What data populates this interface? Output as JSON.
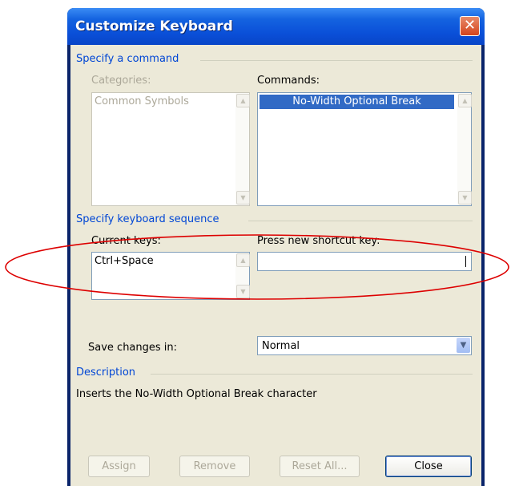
{
  "dialog": {
    "title": "Customize Keyboard",
    "close_glyph": "✕"
  },
  "command_group": {
    "legend": "Specify a command",
    "categories_label": "Categories:",
    "categories_items": [
      "Common Symbols"
    ],
    "commands_label": "Commands:",
    "commands_items": [
      "No-Width Optional Break"
    ]
  },
  "keyboard_group": {
    "legend": "Specify keyboard sequence",
    "current_keys_label": "Current keys:",
    "current_keys_items": [
      "Ctrl+Space"
    ],
    "new_shortcut_label": "Press new shortcut key:",
    "new_shortcut_value": ""
  },
  "save_changes": {
    "label": "Save changes in:",
    "selected": "Normal"
  },
  "description": {
    "legend": "Description",
    "text": "Inserts the No-Width Optional Break character"
  },
  "buttons": {
    "assign": "Assign",
    "remove": "Remove",
    "reset_all": "Reset All...",
    "close": "Close"
  },
  "icons": {
    "scroll_up": "▲",
    "scroll_down": "▼",
    "dropdown": "▼"
  },
  "colors": {
    "title_bar": "#0a4fd8",
    "group_legend": "#0046d5",
    "selection": "#316ac5",
    "annotation": "#dd0000"
  }
}
